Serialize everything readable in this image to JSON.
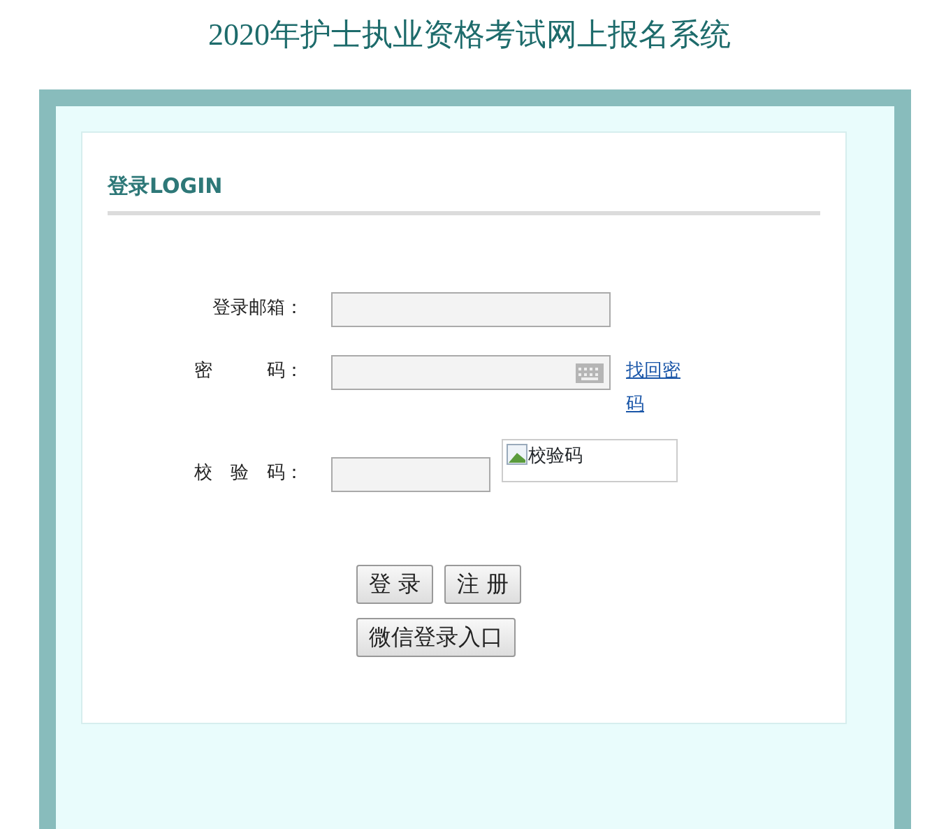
{
  "title": "2020年护士执业资格考试网上报名系统",
  "login_heading": "登录LOGIN",
  "fields": [
    {
      "kind": "text",
      "label": "登录邮箱："
    },
    {
      "kind": "password",
      "label": "密　　　码：",
      "link": "找回密码"
    },
    {
      "kind": "captcha",
      "label": "校　验　码：",
      "image_alt": "校验码"
    }
  ],
  "button_rows": [
    [
      "登 录",
      "注 册"
    ],
    [
      "微信登录入口"
    ]
  ]
}
